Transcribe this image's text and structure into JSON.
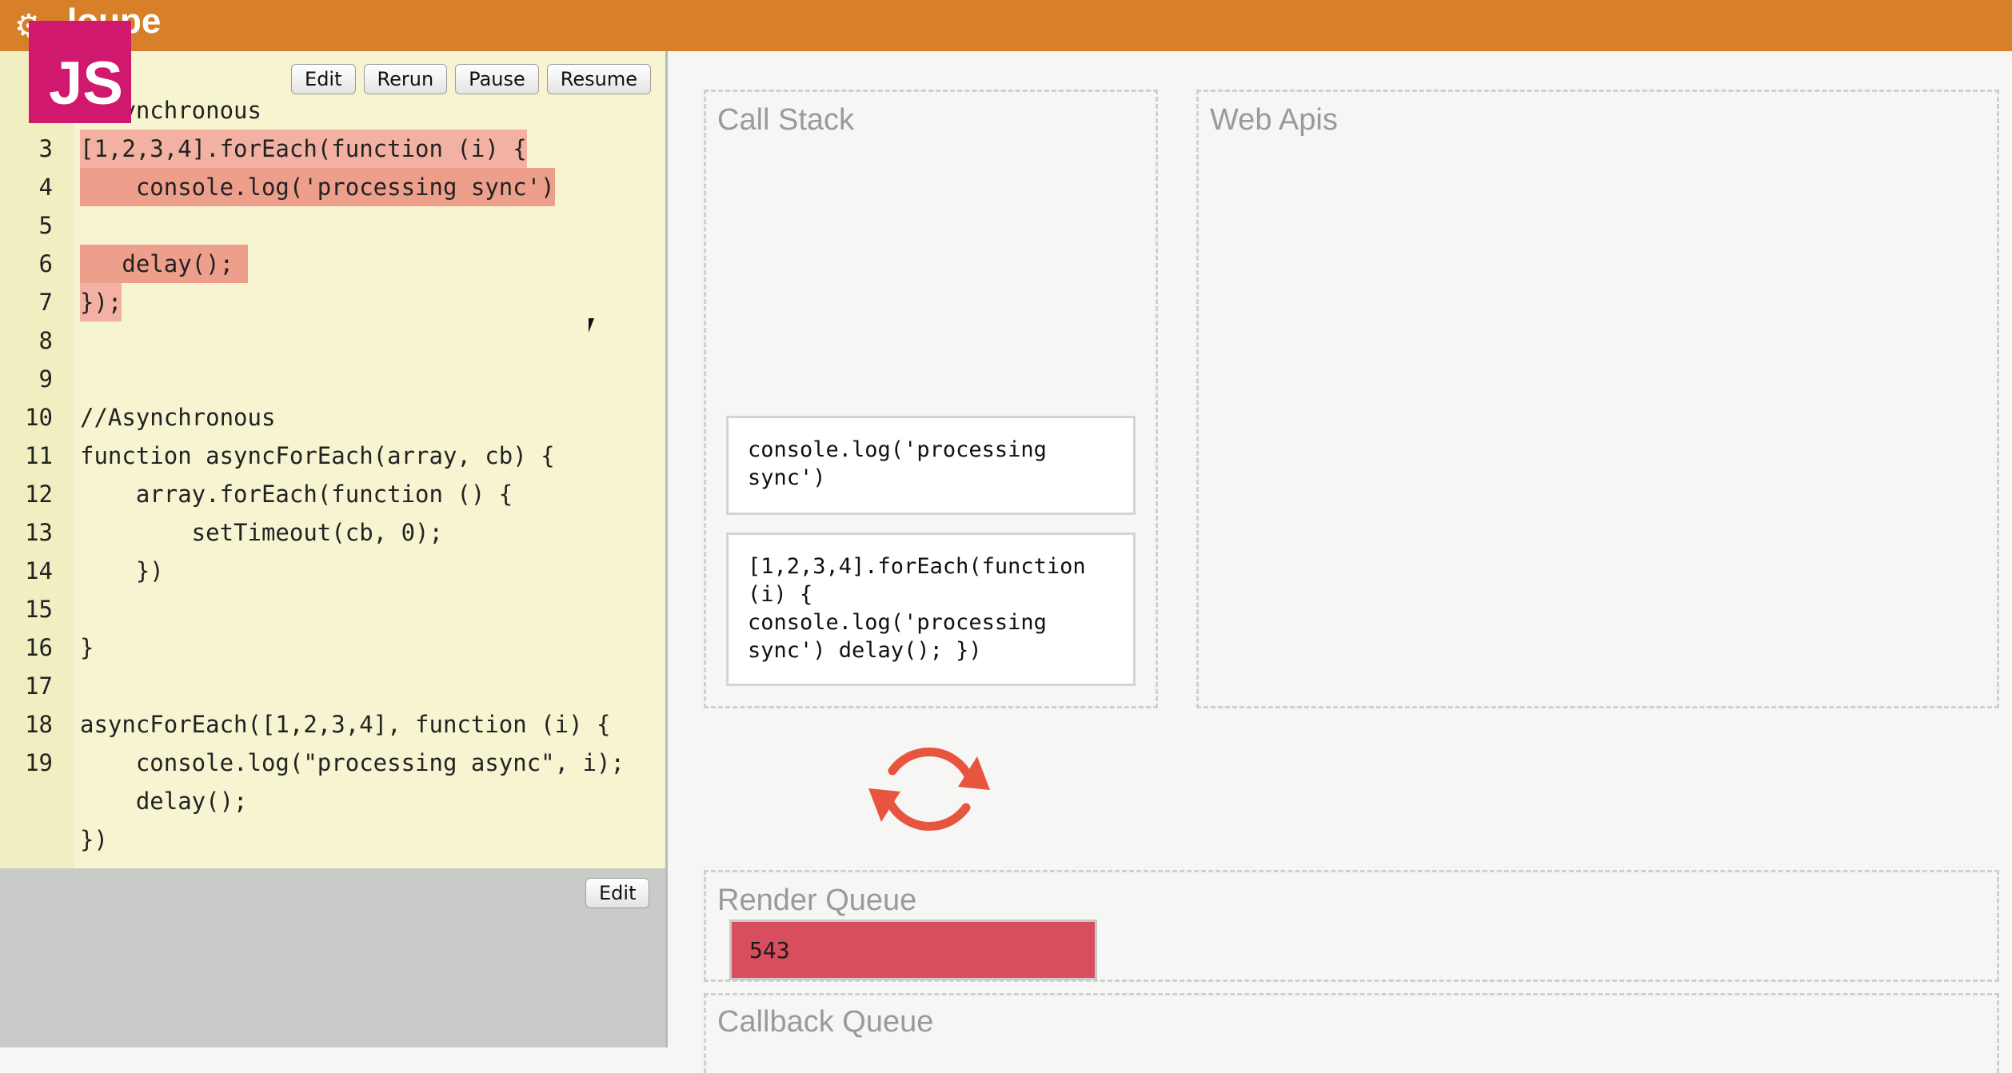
{
  "app": {
    "title": "loupe",
    "logo_glyph": "⚙"
  },
  "badge": {
    "text": "JS",
    "color": "#d0186f"
  },
  "toolbar": {
    "edit_label": "Edit",
    "rerun_label": "Rerun",
    "pause_label": "Pause",
    "resume_label": "Resume"
  },
  "editor": {
    "lines": [
      {
        "num": "",
        "code": "//Synchronous"
      },
      {
        "num": "3",
        "code": "[1,2,3,4].forEach(function (i) {"
      },
      {
        "num": "4",
        "code": "    console.log('processing sync')"
      },
      {
        "num": "5",
        "code": ""
      },
      {
        "num": "6",
        "code": "   delay();"
      },
      {
        "num": "7",
        "code": "});"
      },
      {
        "num": "8",
        "code": ""
      },
      {
        "num": "9",
        "code": ""
      },
      {
        "num": "10",
        "code": "//Asynchronous"
      },
      {
        "num": "11",
        "code": "function asyncForEach(array, cb) {"
      },
      {
        "num": "12",
        "code": "    array.forEach(function () {"
      },
      {
        "num": "13",
        "code": "        setTimeout(cb, 0);"
      },
      {
        "num": "14",
        "code": "    })"
      },
      {
        "num": "15",
        "code": ""
      },
      {
        "num": "16",
        "code": "}"
      },
      {
        "num": "17",
        "code": ""
      },
      {
        "num": "18",
        "code": "asyncForEach([1,2,3,4], function (i) {"
      },
      {
        "num": "19",
        "code": "    console.log(\"processing async\", i);"
      },
      {
        "num": "",
        "code": "    delay();"
      },
      {
        "num": "",
        "code": "})"
      }
    ],
    "bottom_edit_label": "Edit"
  },
  "call_stack": {
    "title": "Call Stack",
    "frames": [
      "console.log('processing sync')",
      "[1,2,3,4].forEach(function (i) { console.log('processing sync') delay(); })"
    ]
  },
  "web_apis": {
    "title": "Web Apis"
  },
  "render_queue": {
    "title": "Render Queue",
    "item": "543",
    "item_color": "#d94e5e"
  },
  "callback_queue": {
    "title": "Callback Queue"
  },
  "colors": {
    "topbar": "#d87f2a",
    "highlight": "#f2b1a3",
    "loop_icon": "#e8553f"
  }
}
